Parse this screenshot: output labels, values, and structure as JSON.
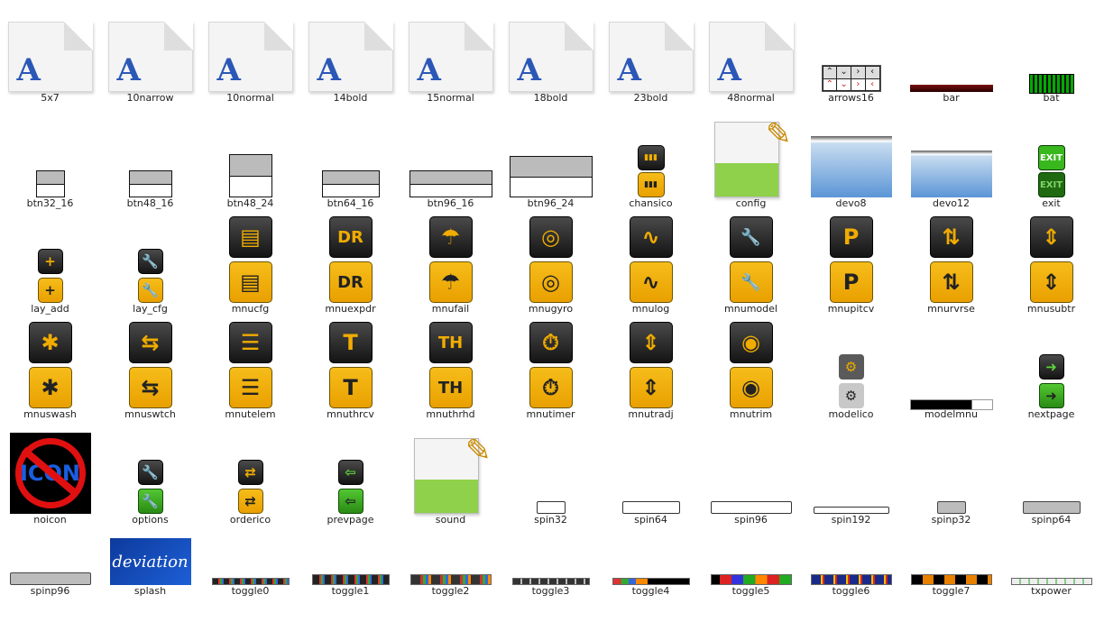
{
  "colors": {
    "accent_yellow": "#f0ac00",
    "icon_black": "#1a1a1a",
    "doc_blue": "#2b57b6",
    "green": "#3fae2c",
    "text": "#222222"
  },
  "items": [
    {
      "name": "5x7",
      "type": "doc"
    },
    {
      "name": "10narrow",
      "type": "doc"
    },
    {
      "name": "10normal",
      "type": "doc"
    },
    {
      "name": "14bold",
      "type": "doc"
    },
    {
      "name": "15normal",
      "type": "doc"
    },
    {
      "name": "18bold",
      "type": "doc"
    },
    {
      "name": "23bold",
      "type": "doc"
    },
    {
      "name": "48normal",
      "type": "doc"
    },
    {
      "name": "arrows16",
      "type": "arrows"
    },
    {
      "name": "bar",
      "type": "bar"
    },
    {
      "name": "bat",
      "type": "bat"
    },
    {
      "name": "btn32_16",
      "type": "btn"
    },
    {
      "name": "btn48_16",
      "type": "btn"
    },
    {
      "name": "btn48_24",
      "type": "btn"
    },
    {
      "name": "btn64_16",
      "type": "btn"
    },
    {
      "name": "btn96_16",
      "type": "btn"
    },
    {
      "name": "btn96_24",
      "type": "btn"
    },
    {
      "name": "chansico",
      "type": "yblk"
    },
    {
      "name": "config",
      "type": "notepad"
    },
    {
      "name": "devo8",
      "type": "devo"
    },
    {
      "name": "devo12",
      "type": "devo"
    },
    {
      "name": "exit",
      "type": "exit",
      "glyph": "EXIT"
    },
    {
      "name": "lay_add",
      "type": "small",
      "glyph": "+"
    },
    {
      "name": "lay_cfg",
      "type": "small",
      "glyph": "🔧"
    },
    {
      "name": "mnucfg",
      "type": "mnu",
      "glyph": "▤"
    },
    {
      "name": "mnuexpdr",
      "type": "mnu",
      "glyph": "DR"
    },
    {
      "name": "mnufail",
      "type": "mnu",
      "glyph": "☂"
    },
    {
      "name": "mnugyro",
      "type": "mnu",
      "glyph": "◎"
    },
    {
      "name": "mnulog",
      "type": "mnu",
      "glyph": "∿"
    },
    {
      "name": "mnumodel",
      "type": "mnu",
      "glyph": "🔧"
    },
    {
      "name": "mnupitcv",
      "type": "mnu",
      "glyph": "P"
    },
    {
      "name": "mnurvrse",
      "type": "mnu",
      "glyph": "⇅"
    },
    {
      "name": "mnusubtr",
      "type": "mnu",
      "glyph": "⇕"
    },
    {
      "name": "mnuswash",
      "type": "mnu",
      "glyph": "✱"
    },
    {
      "name": "mnuswtch",
      "type": "mnu",
      "glyph": "⇆"
    },
    {
      "name": "mnutelem",
      "type": "mnu",
      "glyph": "☰"
    },
    {
      "name": "mnuthrcv",
      "type": "mnu",
      "glyph": "T"
    },
    {
      "name": "mnuthrhd",
      "type": "mnu",
      "glyph": "TH"
    },
    {
      "name": "mnutimer",
      "type": "mnu",
      "glyph": "⏱"
    },
    {
      "name": "mnutradj",
      "type": "mnu",
      "glyph": "⇕"
    },
    {
      "name": "mnutrim",
      "type": "mnu",
      "glyph": "◉"
    },
    {
      "name": "modelico",
      "type": "small",
      "glyph": "⚙"
    },
    {
      "name": "modelmnu",
      "type": "modelmnu"
    },
    {
      "name": "nextpage",
      "type": "small",
      "glyph": "➜"
    },
    {
      "name": "noicon",
      "type": "noicon",
      "glyph": "ICON"
    },
    {
      "name": "options",
      "type": "small",
      "glyph": "🔧"
    },
    {
      "name": "orderico",
      "type": "small",
      "glyph": "⇄"
    },
    {
      "name": "prevpage",
      "type": "small",
      "glyph": "⇦"
    },
    {
      "name": "sound",
      "type": "notepad"
    },
    {
      "name": "spin32",
      "type": "spin"
    },
    {
      "name": "spin64",
      "type": "spin"
    },
    {
      "name": "spin96",
      "type": "spin"
    },
    {
      "name": "spin192",
      "type": "spin"
    },
    {
      "name": "spinp32",
      "type": "spinp"
    },
    {
      "name": "spinp64",
      "type": "spinp"
    },
    {
      "name": "spinp96",
      "type": "spinp"
    },
    {
      "name": "splash",
      "type": "splash",
      "glyph": "deviation"
    },
    {
      "name": "toggle0",
      "type": "toggle"
    },
    {
      "name": "toggle1",
      "type": "toggle"
    },
    {
      "name": "toggle2",
      "type": "toggle"
    },
    {
      "name": "toggle3",
      "type": "toggle"
    },
    {
      "name": "toggle4",
      "type": "toggle"
    },
    {
      "name": "toggle5",
      "type": "toggle"
    },
    {
      "name": "toggle6",
      "type": "toggle"
    },
    {
      "name": "toggle7",
      "type": "toggle"
    },
    {
      "name": "txpower",
      "type": "toggle"
    }
  ]
}
